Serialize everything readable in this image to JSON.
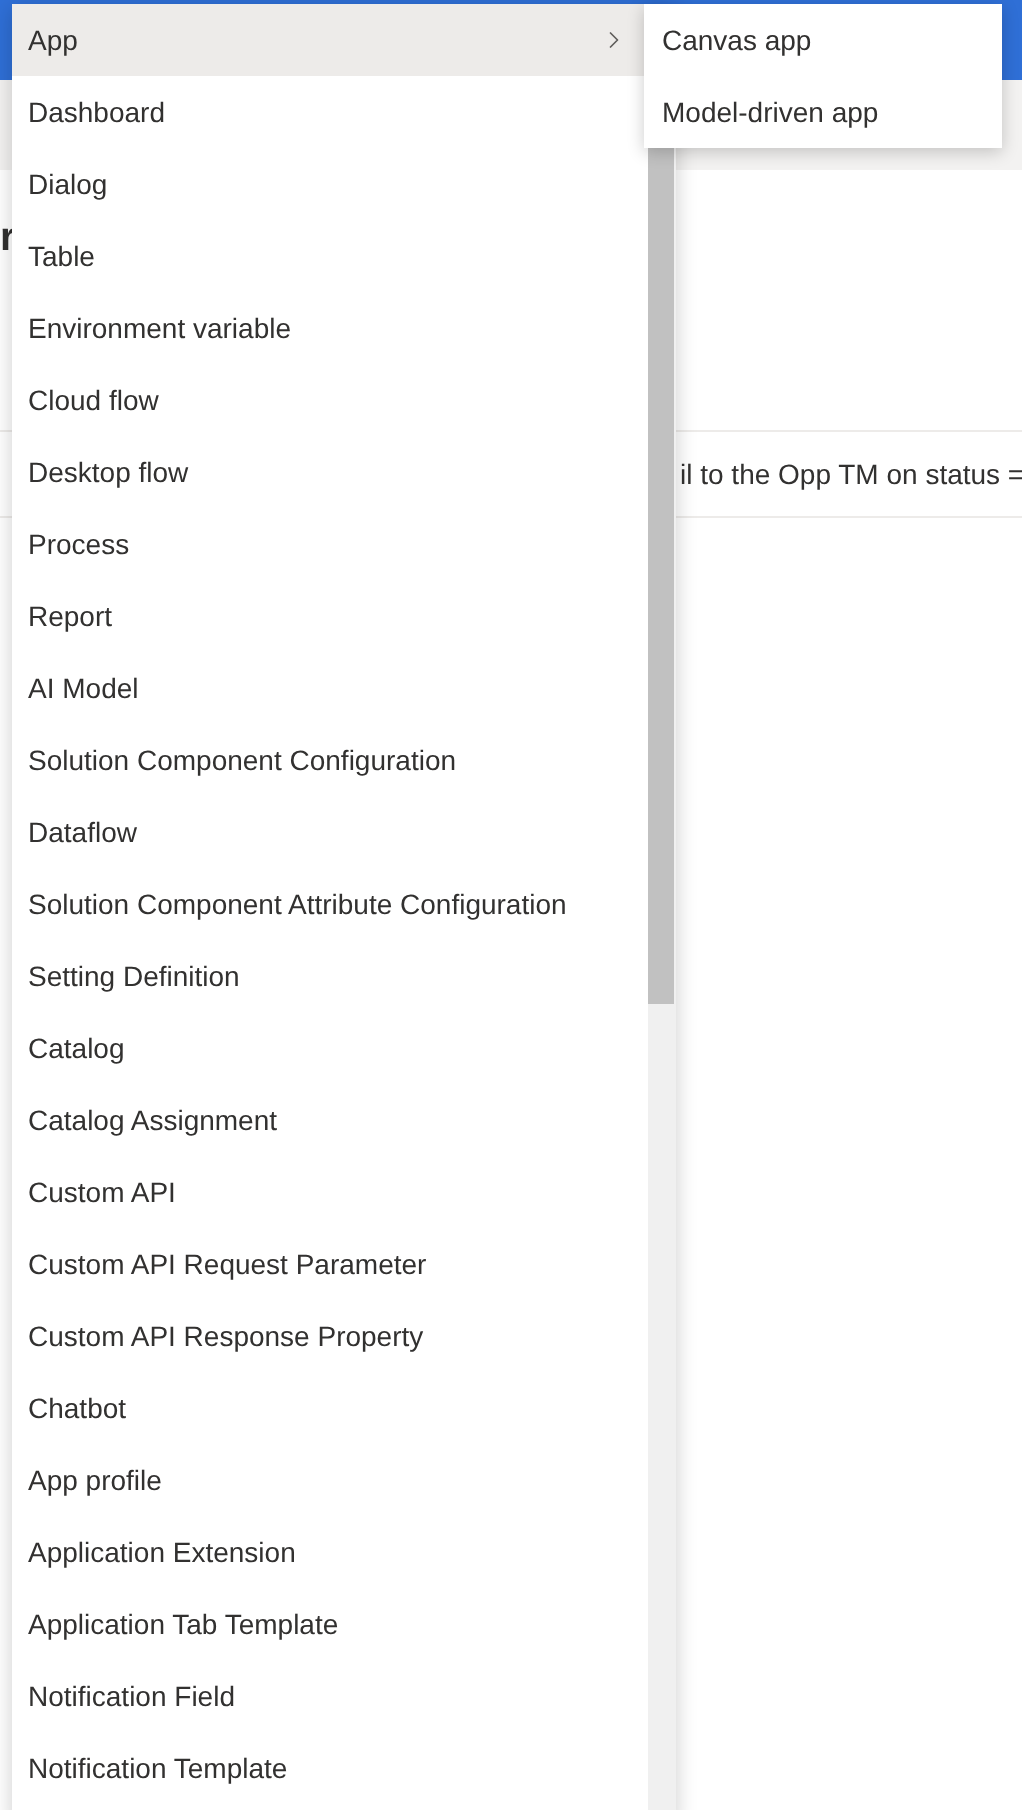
{
  "background": {
    "heading": "r",
    "row": {
      "column_2": "il to the Opp TM on status ="
    }
  },
  "menu": {
    "items": [
      {
        "label": "App",
        "selected": true,
        "has_submenu": true
      },
      {
        "label": "Dashboard",
        "selected": false,
        "has_submenu": false
      },
      {
        "label": "Dialog",
        "selected": false,
        "has_submenu": false
      },
      {
        "label": "Table",
        "selected": false,
        "has_submenu": false
      },
      {
        "label": "Environment variable",
        "selected": false,
        "has_submenu": false
      },
      {
        "label": "Cloud flow",
        "selected": false,
        "has_submenu": false
      },
      {
        "label": "Desktop flow",
        "selected": false,
        "has_submenu": false
      },
      {
        "label": "Process",
        "selected": false,
        "has_submenu": false
      },
      {
        "label": "Report",
        "selected": false,
        "has_submenu": false
      },
      {
        "label": "AI Model",
        "selected": false,
        "has_submenu": false
      },
      {
        "label": "Solution Component Configuration",
        "selected": false,
        "has_submenu": false
      },
      {
        "label": "Dataflow",
        "selected": false,
        "has_submenu": false
      },
      {
        "label": "Solution Component Attribute Configuration",
        "selected": false,
        "has_submenu": false
      },
      {
        "label": "Setting Definition",
        "selected": false,
        "has_submenu": false
      },
      {
        "label": "Catalog",
        "selected": false,
        "has_submenu": false
      },
      {
        "label": "Catalog Assignment",
        "selected": false,
        "has_submenu": false
      },
      {
        "label": "Custom API",
        "selected": false,
        "has_submenu": false
      },
      {
        "label": "Custom API Request Parameter",
        "selected": false,
        "has_submenu": false
      },
      {
        "label": "Custom API Response Property",
        "selected": false,
        "has_submenu": false
      },
      {
        "label": "Chatbot",
        "selected": false,
        "has_submenu": false
      },
      {
        "label": "App profile",
        "selected": false,
        "has_submenu": false
      },
      {
        "label": "Application Extension",
        "selected": false,
        "has_submenu": false
      },
      {
        "label": "Application Tab Template",
        "selected": false,
        "has_submenu": false
      },
      {
        "label": "Notification Field",
        "selected": false,
        "has_submenu": false
      },
      {
        "label": "Notification Template",
        "selected": false,
        "has_submenu": false
      }
    ]
  },
  "submenu": {
    "items": [
      {
        "label": "Canvas app"
      },
      {
        "label": "Model-driven app"
      }
    ]
  }
}
